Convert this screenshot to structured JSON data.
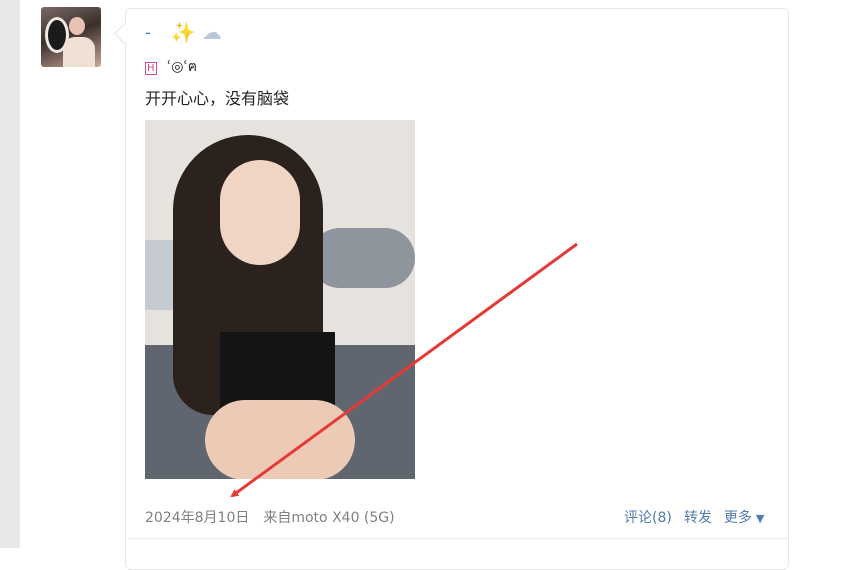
{
  "post": {
    "line1": {
      "dash": "-",
      "sparkles_icon": "✨",
      "cloud_icon": "☁"
    },
    "line2": {
      "h_label": "H",
      "text": "ʿ◎ʿฅ"
    },
    "text": "开开心心，没有脑袋",
    "photo_label": "photo"
  },
  "footer": {
    "date": "2024年8月10日",
    "source": "来自moto X40 (5G)",
    "comment": "评论(8)",
    "forward": "转发",
    "more": "更多",
    "more_caret": "▼"
  },
  "colors": {
    "link": "#507daf",
    "meta": "#808080",
    "arrow": "#e53935"
  }
}
